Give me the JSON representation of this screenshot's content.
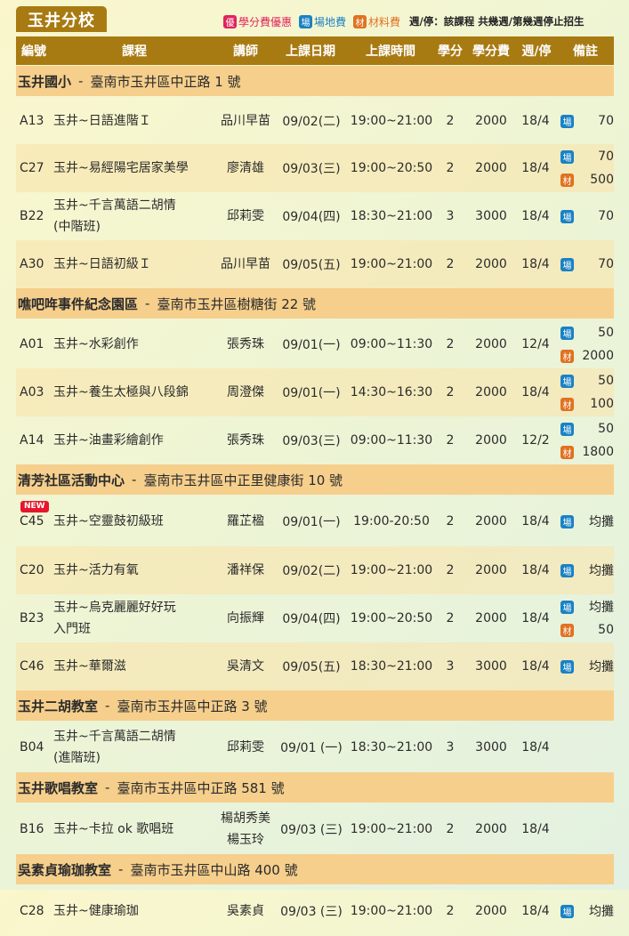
{
  "title": "玉井分校",
  "legend": {
    "discount_icon": "優",
    "discount_label": "學分費優惠",
    "venue_icon": "場",
    "venue_label": "場地費",
    "material_icon": "材",
    "material_label": "材料費",
    "note": "週/停：該課程 共幾週/第幾週停止招生",
    "colors": {
      "discount": "#e0245e",
      "venue": "#1a82c4",
      "material": "#e07222"
    }
  },
  "headers": {
    "code": "編號",
    "course": "課程",
    "teacher": "講師",
    "date": "上課日期",
    "time": "上課時間",
    "credits": "學分",
    "fee": "學分費",
    "weeks": "週/停",
    "notes": "備註"
  },
  "sections": [
    {
      "name": "玉井國小",
      "address": "臺南市玉井區中正路 1 號",
      "rows": [
        {
          "code": "A13",
          "course": [
            "玉井~日語進階Ｉ"
          ],
          "teacher": [
            "品川早苗"
          ],
          "date": "09/02(二)",
          "time": "19:00~21:00",
          "credits": "2",
          "fee": "2000",
          "weeks": "18/4",
          "notes": [
            {
              "type": "venue",
              "icon": "場",
              "value": "70"
            }
          ]
        },
        {
          "code": "C27",
          "course": [
            "玉井~易經陽宅居家美學"
          ],
          "teacher": [
            "廖清雄"
          ],
          "date": "09/03(三)",
          "time": "19:00~20:50",
          "credits": "2",
          "fee": "2000",
          "weeks": "18/4",
          "notes": [
            {
              "type": "venue",
              "icon": "場",
              "value": "70"
            },
            {
              "type": "mat",
              "icon": "材",
              "value": "500"
            }
          ]
        },
        {
          "code": "B22",
          "course": [
            "玉井~千言萬語二胡情",
            "(中階班)"
          ],
          "teacher": [
            "邱莉雯"
          ],
          "date": "09/04(四)",
          "time": "18:30~21:00",
          "credits": "3",
          "fee": "3000",
          "weeks": "18/4",
          "notes": [
            {
              "type": "venue",
              "icon": "場",
              "value": "70"
            }
          ]
        },
        {
          "code": "A30",
          "course": [
            "玉井~日語初級Ｉ"
          ],
          "teacher": [
            "品川早苗"
          ],
          "date": "09/05(五)",
          "time": "19:00~21:00",
          "credits": "2",
          "fee": "2000",
          "weeks": "18/4",
          "notes": [
            {
              "type": "venue",
              "icon": "場",
              "value": "70"
            }
          ]
        }
      ]
    },
    {
      "name": "噍吧哖事件紀念園區",
      "address": "臺南市玉井區樹糖街 22 號",
      "rows": [
        {
          "code": "A01",
          "course": [
            "玉井~水彩創作"
          ],
          "teacher": [
            "張秀珠"
          ],
          "date": "09/01(一)",
          "time": "09:00~11:30",
          "credits": "2",
          "fee": "2000",
          "weeks": "12/4",
          "notes": [
            {
              "type": "venue",
              "icon": "場",
              "value": "50"
            },
            {
              "type": "mat",
              "icon": "材",
              "value": "2000"
            }
          ]
        },
        {
          "code": "A03",
          "course": [
            "玉井~養生太極與八段錦"
          ],
          "teacher": [
            "周澄傑"
          ],
          "date": "09/01(一)",
          "time": "14:30~16:30",
          "credits": "2",
          "fee": "2000",
          "weeks": "18/4",
          "notes": [
            {
              "type": "venue",
              "icon": "場",
              "value": "50"
            },
            {
              "type": "mat",
              "icon": "材",
              "value": "100"
            }
          ]
        },
        {
          "code": "A14",
          "course": [
            "玉井~油畫彩繪創作"
          ],
          "teacher": [
            "張秀珠"
          ],
          "date": "09/03(三)",
          "time": "09:00~11:30",
          "credits": "2",
          "fee": "2000",
          "weeks": "12/2",
          "notes": [
            {
              "type": "venue",
              "icon": "場",
              "value": "50"
            },
            {
              "type": "mat",
              "icon": "材",
              "value": "1800"
            }
          ]
        }
      ]
    },
    {
      "name": "清芳社區活動中心",
      "address": "臺南市玉井區中正里健康街 10 號",
      "rows": [
        {
          "code": "C45",
          "new": "NEW",
          "course": [
            "玉井~空靈鼓初級班"
          ],
          "teacher": [
            "羅芷楹"
          ],
          "date": "09/01(一)",
          "time": "19:00-20:50",
          "credits": "2",
          "fee": "2000",
          "weeks": "18/4",
          "notes": [
            {
              "type": "venue",
              "icon": "場",
              "value": "均攤"
            }
          ]
        },
        {
          "code": "C20",
          "course": [
            "玉井~活力有氧"
          ],
          "teacher": [
            "潘祥保"
          ],
          "date": "09/02(二)",
          "time": "19:00~21:00",
          "credits": "2",
          "fee": "2000",
          "weeks": "18/4",
          "notes": [
            {
              "type": "venue",
              "icon": "場",
              "value": "均攤"
            }
          ]
        },
        {
          "code": "B23",
          "course": [
            "玉井~烏克麗麗好好玩",
            "入門班"
          ],
          "teacher": [
            "向振輝"
          ],
          "date": "09/04(四)",
          "time": "19:00~20:50",
          "credits": "2",
          "fee": "2000",
          "weeks": "18/4",
          "notes": [
            {
              "type": "venue",
              "icon": "場",
              "value": "均攤"
            },
            {
              "type": "mat",
              "icon": "材",
              "value": "50"
            }
          ]
        },
        {
          "code": "C46",
          "course": [
            "玉井~華爾滋"
          ],
          "teacher": [
            "吳清文"
          ],
          "date": "09/05(五)",
          "time": "18:30~21:00",
          "credits": "3",
          "fee": "3000",
          "weeks": "18/4",
          "notes": [
            {
              "type": "venue",
              "icon": "場",
              "value": "均攤"
            }
          ]
        }
      ]
    },
    {
      "name": "玉井二胡教室",
      "address": "臺南市玉井區中正路 3 號",
      "rows": [
        {
          "code": "B04",
          "course": [
            "玉井~千言萬語二胡情",
            "(進階班)"
          ],
          "teacher": [
            "邱莉雯"
          ],
          "date": "09/01 (一)",
          "time": "18:30~21:00",
          "credits": "3",
          "fee": "3000",
          "weeks": "18/4",
          "notes": []
        }
      ]
    },
    {
      "name": "玉井歌唱教室",
      "address": "臺南市玉井區中正路 581 號",
      "rows": [
        {
          "code": "B16",
          "course": [
            "玉井~卡拉 ok 歌唱班"
          ],
          "teacher": [
            "楊胡秀美",
            "楊玉玲"
          ],
          "date": "09/03 (三)",
          "time": "19:00~21:00",
          "credits": "2",
          "fee": "2000",
          "weeks": "18/4",
          "notes": []
        }
      ]
    },
    {
      "name": "吳素貞瑜珈教室",
      "address": "臺南市玉井區中山路 400 號",
      "rows": [
        {
          "code": "C28",
          "course": [
            "玉井~健康瑜珈"
          ],
          "teacher": [
            "吳素貞"
          ],
          "date": "09/03 (三)",
          "time": "19:00~21:00",
          "credits": "2",
          "fee": "2000",
          "weeks": "18/4",
          "notes": [
            {
              "type": "venue",
              "icon": "場",
              "value": "均攤"
            }
          ]
        }
      ]
    }
  ]
}
